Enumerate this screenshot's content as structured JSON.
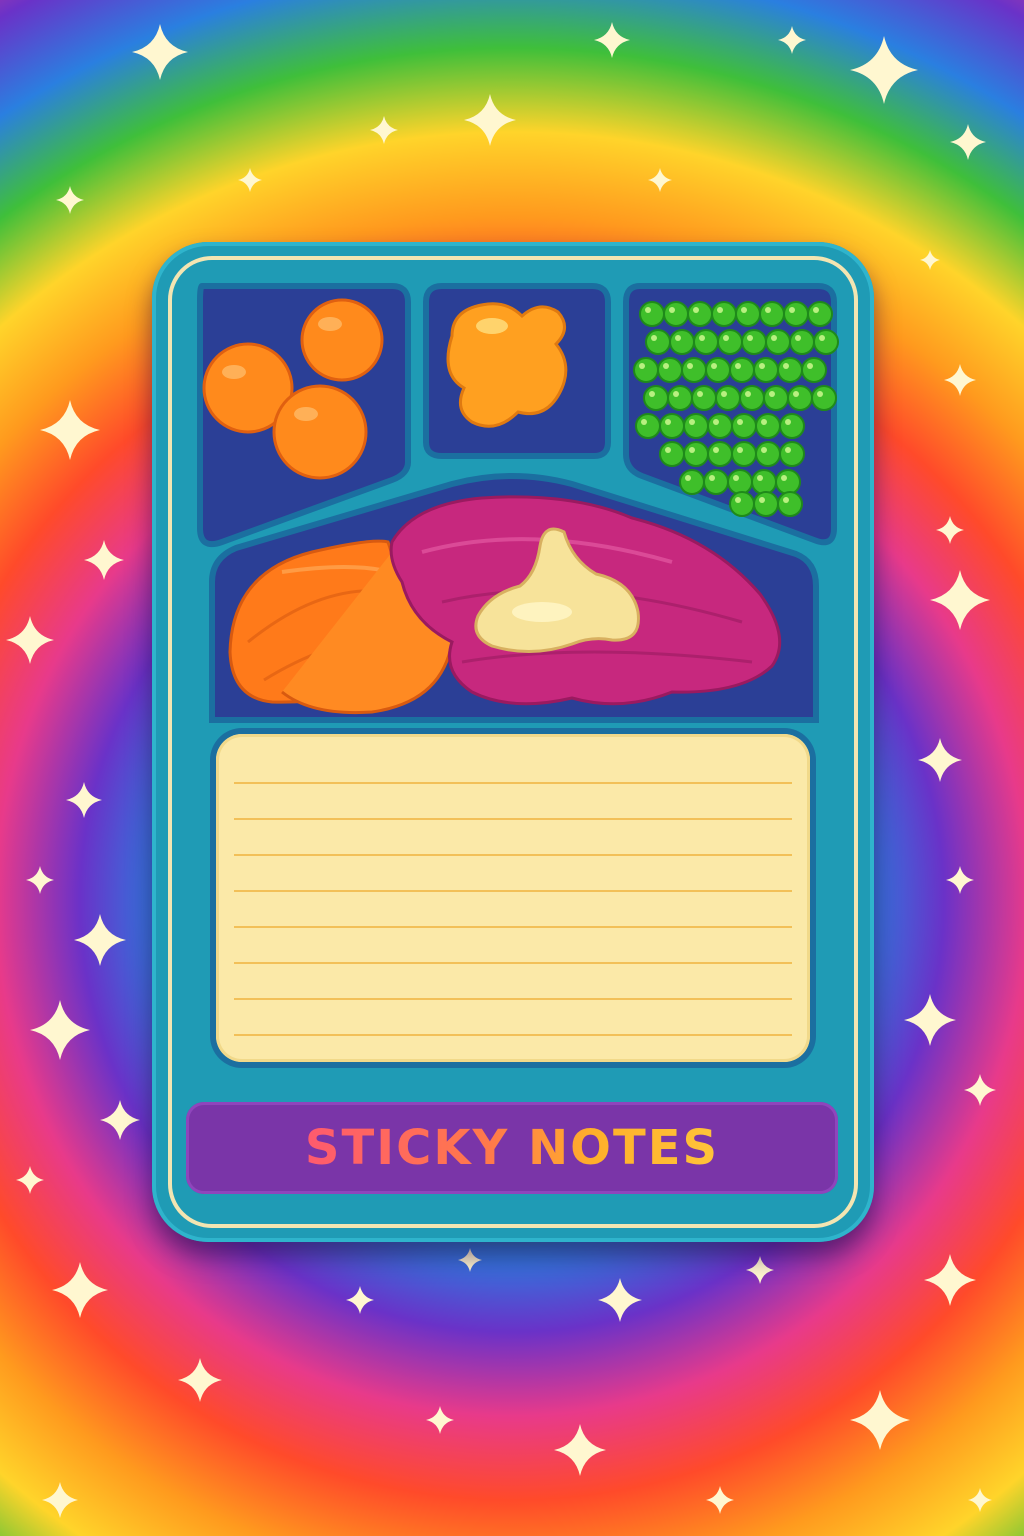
{
  "title": "STICKY NOTES",
  "note": {
    "line_count": 8
  },
  "colors": {
    "tray": "#1f9bb5",
    "compartment": "#2b3f96",
    "note_paper": "#fbe9a8",
    "note_lines": "#f0b84a",
    "label_bar": "#7a35a8",
    "oranges": "#ff8a1c",
    "peas": "#3fbf2a",
    "beets": "#c7287e",
    "carrots": "#ff7a1a",
    "butter": "#f7e39a"
  },
  "icons": [
    "orange-balls-icon",
    "cheese-nugget-icon",
    "peas-icon",
    "carrot-sticks-icon",
    "mashed-beets-icon",
    "butter-pat-icon",
    "sparkle-icon"
  ]
}
